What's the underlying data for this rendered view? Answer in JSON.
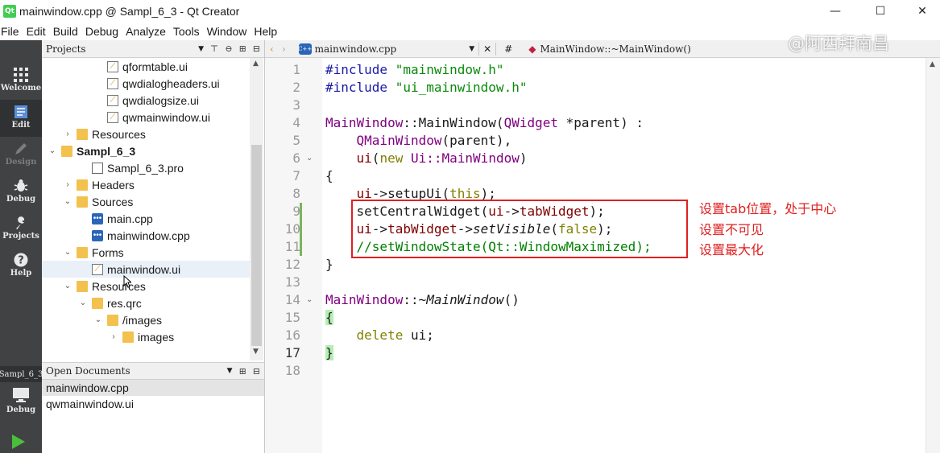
{
  "window": {
    "title": "mainwindow.cpp @ Sampl_6_3 - Qt Creator",
    "logo": "Qt",
    "minimize": "—",
    "maximize": "☐",
    "close": "✕"
  },
  "menu": [
    "File",
    "Edit",
    "Build",
    "Debug",
    "Analyze",
    "Tools",
    "Window",
    "Help"
  ],
  "modes": [
    {
      "label": "Welcome",
      "icon": "grid-icon"
    },
    {
      "label": "Edit",
      "icon": "document-icon"
    },
    {
      "label": "Design",
      "icon": "pencil-icon"
    },
    {
      "label": "Debug",
      "icon": "bug-icon"
    },
    {
      "label": "Projects",
      "icon": "wrench-icon"
    },
    {
      "label": "Help",
      "icon": "help-icon"
    }
  ],
  "bottom_modes": {
    "target_label": "Sampl_6_3",
    "debug_label": "Debug",
    "run_icon": "run-icon"
  },
  "projects": {
    "header": "Projects",
    "tree": [
      {
        "text": "qformtable.ui",
        "indent": 3,
        "icon": "ui",
        "arrow": ""
      },
      {
        "text": "qwdialogheaders.ui",
        "indent": 3,
        "icon": "ui",
        "arrow": ""
      },
      {
        "text": "qwdialogsize.ui",
        "indent": 3,
        "icon": "ui",
        "arrow": ""
      },
      {
        "text": "qwmainwindow.ui",
        "indent": 3,
        "icon": "ui",
        "arrow": ""
      },
      {
        "text": "Resources",
        "indent": 1,
        "icon": "folder",
        "arrow": "›"
      },
      {
        "text": "Sampl_6_3",
        "indent": 0,
        "icon": "folder",
        "arrow": "⌄",
        "bold": true
      },
      {
        "text": "Sampl_6_3.pro",
        "indent": 2,
        "icon": "pro",
        "arrow": ""
      },
      {
        "text": "Headers",
        "indent": 1,
        "icon": "folder",
        "arrow": "›"
      },
      {
        "text": "Sources",
        "indent": 1,
        "icon": "folder",
        "arrow": "⌄"
      },
      {
        "text": "main.cpp",
        "indent": 2,
        "icon": "cpp",
        "arrow": ""
      },
      {
        "text": "mainwindow.cpp",
        "indent": 2,
        "icon": "cpp",
        "arrow": ""
      },
      {
        "text": "Forms",
        "indent": 1,
        "icon": "folder",
        "arrow": "⌄"
      },
      {
        "text": "mainwindow.ui",
        "indent": 2,
        "icon": "ui",
        "arrow": "",
        "selected": true
      },
      {
        "text": "Resources",
        "indent": 1,
        "icon": "folder",
        "arrow": "⌄"
      },
      {
        "text": "res.qrc",
        "indent": 2,
        "icon": "folder",
        "arrow": "⌄"
      },
      {
        "text": "/images",
        "indent": 3,
        "icon": "folder",
        "arrow": "⌄"
      },
      {
        "text": "images",
        "indent": 4,
        "icon": "folder",
        "arrow": "›"
      }
    ]
  },
  "open_documents": {
    "header": "Open Documents",
    "items": [
      "mainwindow.cpp",
      "qwmainwindow.ui"
    ]
  },
  "editor": {
    "file_tab": "mainwindow.cpp",
    "symbol": "MainWindow::~MainWindow()",
    "hash": "#",
    "watermark": "@阿西拜南昌",
    "line_numbers": [
      "1",
      "2",
      "3",
      "4",
      "5",
      "6",
      "7",
      "8",
      "9",
      "10",
      "11",
      "12",
      "13",
      "14",
      "15",
      "16",
      "17",
      "18"
    ],
    "current_line": "17",
    "code": {
      "l1a": "#include",
      "l1b": "\"mainwindow.h\"",
      "l2a": "#include",
      "l2b": "\"ui_mainwindow.h\"",
      "l4a": "MainWindow",
      "l4b": "::",
      "l4c": "MainWindow",
      "l4d": "(",
      "l4e": "QWidget",
      "l4f": " *parent) :",
      "l5a": "QMainWindow",
      "l5b": "(parent),",
      "l6a": "ui",
      "l6b": "(",
      "l6c": "new",
      "l6d": " ",
      "l6e": "Ui::MainWindow",
      "l6f": ")",
      "l7": "{",
      "l8a": "ui",
      "l8b": "->setupUi(",
      "l8c": "this",
      "l8d": ");",
      "l9a": "setCentralWidget(",
      "l9b": "ui",
      "l9c": "->",
      "l9d": "tabWidget",
      "l9e": ");",
      "l10a": "ui",
      "l10b": "->",
      "l10c": "tabWidget",
      "l10d": "->",
      "l10e": "setVisible",
      "l10f": "(",
      "l10g": "false",
      "l10h": ");",
      "l11": "//setWindowState(Qt::WindowMaximized);",
      "l12": "}",
      "l14a": "MainWindow",
      "l14b": "::~",
      "l14c": "MainWindow",
      "l14d": "()",
      "l15": "{",
      "l16a": "delete",
      "l16b": " ui;",
      "l17": "}"
    }
  },
  "annotations": [
    "设置tab位置，处于中心",
    "设置不可见",
    "设置最大化"
  ],
  "colors": {
    "annotation": "#e02020",
    "modebar": "#404244"
  }
}
